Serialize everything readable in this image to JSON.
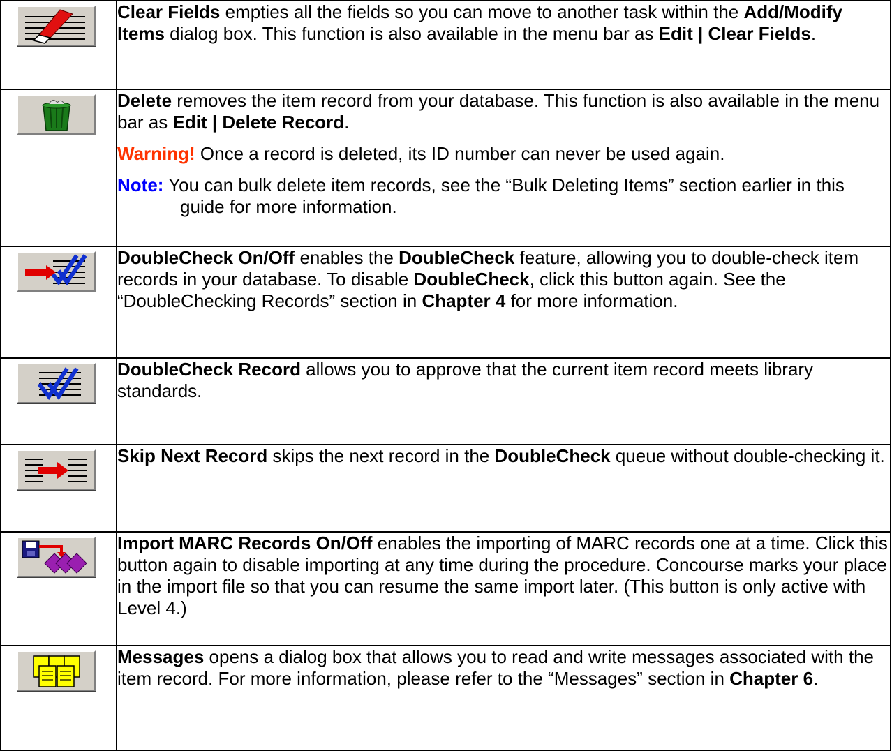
{
  "rows": [
    {
      "icon": "clear-fields-icon",
      "parts": [
        "Clear Fields",
        " empties all the fields so you can move to another task within the ",
        "Add/Modify Items",
        " dialog box. This function is also available in the menu bar as ",
        "Edit | Clear Fields",
        "."
      ]
    },
    {
      "icon": "delete-trash-icon",
      "parts": [
        "Delete",
        " removes the item record from your database. This function is also available in the menu bar as ",
        "Edit | Delete Record",
        "."
      ],
      "warning_label": "Warning!",
      "warning_text": " Once a record is deleted, its ID number can never be used again.",
      "note_label": "Note:",
      "note_text": " You can bulk delete item records, see the “Bulk Deleting Items” section earlier in this guide for more information."
    },
    {
      "icon": "doublecheck-on-off-icon",
      "parts": [
        "DoubleCheck On/Off",
        " enables the ",
        "DoubleCheck",
        " feature, allowing you to double-check item records in your database. To disable ",
        "DoubleCheck",
        ", click this button again. See the “DoubleChecking Records” section in ",
        "Chapter 4",
        " for more information."
      ]
    },
    {
      "icon": "doublecheck-record-icon",
      "parts": [
        "DoubleCheck Record",
        " allows you to approve that the current item record meets library standards."
      ]
    },
    {
      "icon": "skip-next-record-icon",
      "parts": [
        "Skip Next Record",
        " skips the next record in the ",
        "DoubleCheck",
        " queue without double-checking it."
      ]
    },
    {
      "icon": "import-marc-records-icon",
      "parts": [
        "Import MARC Records On/Off",
        " enables the importing of MARC records one at a time. Click this button again to disable importing at any time during the procedure. Concourse marks your place in the import file so that you can resume the same import later. (This button is only active with Level 4.)"
      ]
    },
    {
      "icon": "messages-icon",
      "parts": [
        "Messages",
        " opens a dialog box that allows you to read and write messages associated with the item record. For more information, please refer to the “Messages” section in ",
        "Chapter 6",
        "."
      ]
    }
  ]
}
